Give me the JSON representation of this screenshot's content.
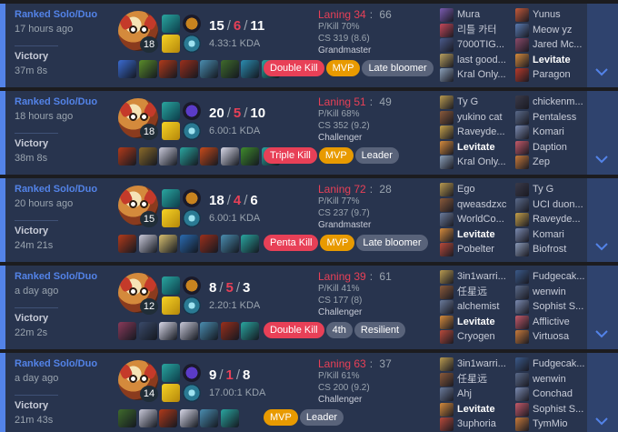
{
  "matches": [
    {
      "queue": "Ranked Solo/Duo",
      "time_ago": "17 hours ago",
      "result": "Victory",
      "duration": "37m 8s",
      "level": "18",
      "kills": "15",
      "deaths": "6",
      "assists": "11",
      "kda_ratio": "4.33:1 KDA",
      "keystone_color": "#c8831f",
      "laning_score": "Laning 34",
      "laning_opp": "66",
      "pkill": "P/Kill 70%",
      "cs": "CS 319 (8.6)",
      "tier": "Grandmaster",
      "item_colors": [
        "#3a6bd1",
        "#5a8c2a",
        "#b23a1a",
        "#9b2f1b",
        "#4a8db0",
        "#3f6b2c",
        "#2b8cb0",
        "#2aa6a0"
      ],
      "badges": [
        {
          "label": "Double Kill",
          "kind": "red"
        },
        {
          "label": "MVP",
          "kind": "gold"
        },
        {
          "label": "Late bloomer",
          "kind": "gray"
        }
      ],
      "team_blue": [
        {
          "name": "Mura",
          "icon_color": "#7a5bb0",
          "me": false
        },
        {
          "name": "리틀 카터",
          "icon_color": "#c4485a",
          "me": false
        },
        {
          "name": "7000TIG...",
          "icon_color": "#4a5a8a",
          "me": false
        },
        {
          "name": "last good...",
          "icon_color": "#b8a060",
          "me": false
        },
        {
          "name": "Kral Only...",
          "icon_color": "#8a9fb8",
          "me": false
        }
      ],
      "team_red": [
        {
          "name": "Yunus",
          "icon_color": "#c45a3a",
          "me": false
        },
        {
          "name": "Meow yz",
          "icon_color": "#5a7ab0",
          "me": false
        },
        {
          "name": "Jared Mc...",
          "icon_color": "#8a4a6a",
          "me": false
        },
        {
          "name": "Levitate",
          "icon_color": "#d48a3c",
          "me": true
        },
        {
          "name": "Paragon",
          "icon_color": "#b83a2a",
          "me": false
        }
      ]
    },
    {
      "queue": "Ranked Solo/Duo",
      "time_ago": "18 hours ago",
      "result": "Victory",
      "duration": "38m 8s",
      "level": "18",
      "kills": "20",
      "deaths": "5",
      "assists": "10",
      "kda_ratio": "6.00:1 KDA",
      "keystone_color": "#5b3bc8",
      "laning_score": "Laning 51",
      "laning_opp": "49",
      "pkill": "P/Kill 68%",
      "cs": "CS 352 (9.2)",
      "tier": "Challenger",
      "item_colors": [
        "#b23a1a",
        "#8a6a2a",
        "#c8c8d8",
        "#2aa6a0",
        "#c84a1a",
        "#d8d8e8",
        "#3f8b2c",
        "#2aa6a0"
      ],
      "badges": [
        {
          "label": "Triple Kill",
          "kind": "red"
        },
        {
          "label": "MVP",
          "kind": "gold"
        },
        {
          "label": "Leader",
          "kind": "gray"
        }
      ],
      "team_blue": [
        {
          "name": "Ty G",
          "icon_color": "#b89a50",
          "me": false
        },
        {
          "name": "yukino cat",
          "icon_color": "#8a5a3a",
          "me": false
        },
        {
          "name": "Raveyde...",
          "icon_color": "#c4a04a",
          "me": false
        },
        {
          "name": "Levitate",
          "icon_color": "#d48a3c",
          "me": true
        },
        {
          "name": "Kral Only...",
          "icon_color": "#8a9fb8",
          "me": false
        }
      ],
      "team_red": [
        {
          "name": "chickenm...",
          "icon_color": "#3a3a4a",
          "me": false
        },
        {
          "name": "Pentaless",
          "icon_color": "#5a6a8a",
          "me": false
        },
        {
          "name": "Komari",
          "icon_color": "#7a8ab0",
          "me": false
        },
        {
          "name": "Daption",
          "icon_color": "#c45a6a",
          "me": false
        },
        {
          "name": "Zep",
          "icon_color": "#c87a3a",
          "me": false
        }
      ]
    },
    {
      "queue": "Ranked Solo/Duo",
      "time_ago": "20 hours ago",
      "result": "Victory",
      "duration": "24m 21s",
      "level": "15",
      "kills": "18",
      "deaths": "4",
      "assists": "6",
      "kda_ratio": "6.00:1 KDA",
      "keystone_color": "#c8831f",
      "laning_score": "Laning 72",
      "laning_opp": "28",
      "pkill": "P/Kill 77%",
      "cs": "CS 237 (9.7)",
      "tier": "Grandmaster",
      "item_colors": [
        "#b23a1a",
        "#c8c8d8",
        "#d8c070",
        "#2a6ab0",
        "#9b2f1b",
        "#4a8db0",
        "#2aa6a0"
      ],
      "badges": [
        {
          "label": "Penta Kill",
          "kind": "red"
        },
        {
          "label": "MVP",
          "kind": "gold"
        },
        {
          "label": "Late bloomer",
          "kind": "gray"
        }
      ],
      "team_blue": [
        {
          "name": "Ego",
          "icon_color": "#b89a50",
          "me": false
        },
        {
          "name": "qweasdzxc",
          "icon_color": "#8a5a3a",
          "me": false
        },
        {
          "name": "WorldCo...",
          "icon_color": "#6a7a9a",
          "me": false
        },
        {
          "name": "Levitate",
          "icon_color": "#d48a3c",
          "me": true
        },
        {
          "name": "Pobelter",
          "icon_color": "#b84a3a",
          "me": false
        }
      ],
      "team_red": [
        {
          "name": "Ty G",
          "icon_color": "#3a3a4a",
          "me": false
        },
        {
          "name": "UCI duon...",
          "icon_color": "#5a6a8a",
          "me": false
        },
        {
          "name": "Raveyde...",
          "icon_color": "#c4a04a",
          "me": false
        },
        {
          "name": "Komari",
          "icon_color": "#7a8ab0",
          "me": false
        },
        {
          "name": "Biofrost",
          "icon_color": "#8a9ab8",
          "me": false
        }
      ]
    },
    {
      "queue": "Ranked Solo/Duo",
      "time_ago": "a day ago",
      "result": "Victory",
      "duration": "22m 2s",
      "level": "12",
      "kills": "8",
      "deaths": "5",
      "assists": "3",
      "kda_ratio": "2.20:1 KDA",
      "keystone_color": "#c8831f",
      "laning_score": "Laning 39",
      "laning_opp": "61",
      "pkill": "P/Kill 41%",
      "cs": "CS 177 (8)",
      "tier": "Challenger",
      "item_colors": [
        "#8a3a5a",
        "#3a4a6a",
        "#d8d8e8",
        "#c8c8d8",
        "#4a8db0",
        "#9b2f1b",
        "#2aa6a0"
      ],
      "badges": [
        {
          "label": "Double Kill",
          "kind": "red"
        },
        {
          "label": "4th",
          "kind": "gray"
        },
        {
          "label": "Resilient",
          "kind": "gray"
        }
      ],
      "team_blue": [
        {
          "name": "3in1warri...",
          "icon_color": "#b89a50",
          "me": false
        },
        {
          "name": "任星远",
          "icon_color": "#8a5a3a",
          "me": false
        },
        {
          "name": "alchemist",
          "icon_color": "#6a7a9a",
          "me": false
        },
        {
          "name": "Levitate",
          "icon_color": "#d48a3c",
          "me": true
        },
        {
          "name": "Cryogen",
          "icon_color": "#b84a3a",
          "me": false
        }
      ],
      "team_red": [
        {
          "name": "Fudgecak...",
          "icon_color": "#3a5a8a",
          "me": false
        },
        {
          "name": "wenwin",
          "icon_color": "#5a6a8a",
          "me": false
        },
        {
          "name": "Sophist S...",
          "icon_color": "#7a8ab0",
          "me": false
        },
        {
          "name": "Afflictive",
          "icon_color": "#c45a6a",
          "me": false
        },
        {
          "name": "Virtuosa",
          "icon_color": "#c87a3a",
          "me": false
        }
      ]
    },
    {
      "queue": "Ranked Solo/Duo",
      "time_ago": "a day ago",
      "result": "Victory",
      "duration": "21m 43s",
      "level": "14",
      "kills": "9",
      "deaths": "1",
      "assists": "8",
      "kda_ratio": "17.00:1 KDA",
      "keystone_color": "#5b3bc8",
      "laning_score": "Laning 63",
      "laning_opp": "37",
      "pkill": "P/Kill 61%",
      "cs": "CS 200 (9.2)",
      "tier": "Challenger",
      "item_colors": [
        "#3f6b2c",
        "#c8c8d8",
        "#b23a1a",
        "#d8d8e8",
        "#4a8db0",
        "#2aa6a0"
      ],
      "badges": [
        {
          "label": "MVP",
          "kind": "gold"
        },
        {
          "label": "Leader",
          "kind": "gray"
        }
      ],
      "team_blue": [
        {
          "name": "3in1warri...",
          "icon_color": "#b89a50",
          "me": false
        },
        {
          "name": "任星远",
          "icon_color": "#8a5a3a",
          "me": false
        },
        {
          "name": "Ahj",
          "icon_color": "#6a7a9a",
          "me": false
        },
        {
          "name": "Levitate",
          "icon_color": "#d48a3c",
          "me": true
        },
        {
          "name": "3uphoria",
          "icon_color": "#b84a3a",
          "me": false
        }
      ],
      "team_red": [
        {
          "name": "Fudgecak...",
          "icon_color": "#3a5a8a",
          "me": false
        },
        {
          "name": "wenwin",
          "icon_color": "#5a6a8a",
          "me": false
        },
        {
          "name": "Conchad",
          "icon_color": "#7a8ab0",
          "me": false
        },
        {
          "name": "Sophist S...",
          "icon_color": "#c45a6a",
          "me": false
        },
        {
          "name": "TymMio",
          "icon_color": "#c87a3a",
          "me": false
        }
      ]
    }
  ]
}
